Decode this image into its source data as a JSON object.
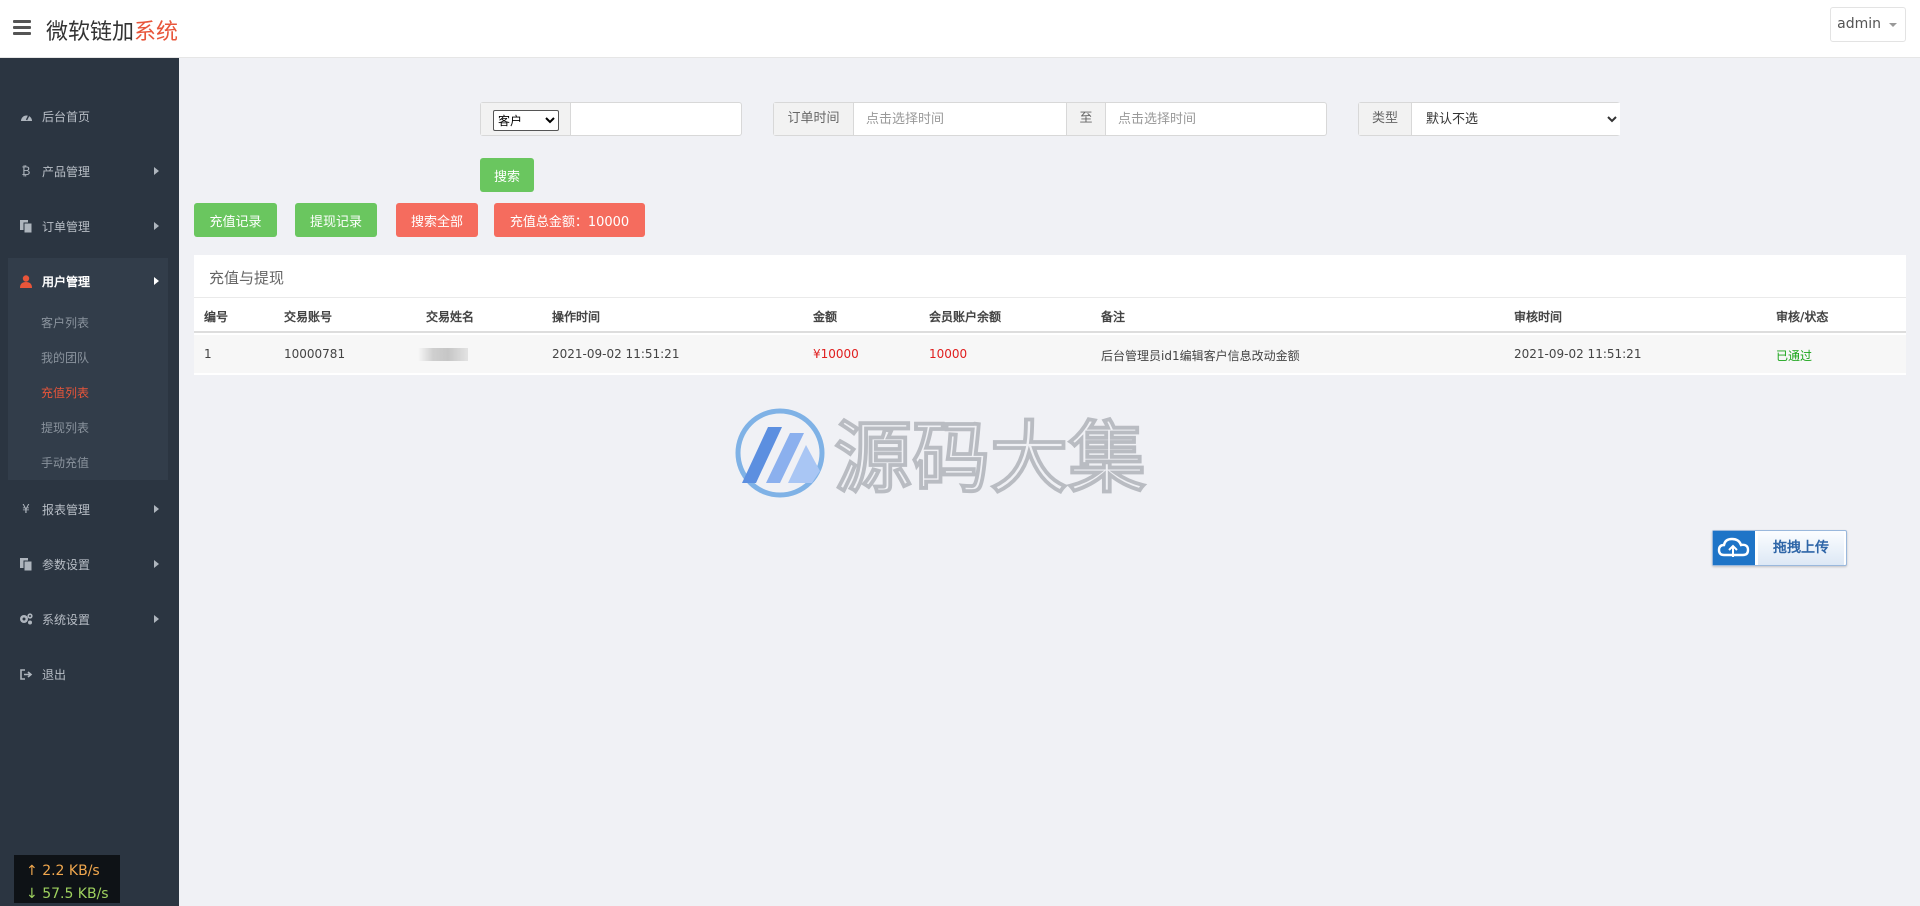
{
  "header": {
    "brand_main": "微软链加",
    "brand_accent": "系统",
    "user_label": "admin"
  },
  "sidebar": {
    "items": [
      {
        "label": "后台首页",
        "icon": "dashboard-icon"
      },
      {
        "label": "产品管理",
        "icon": "bitcoin-icon"
      },
      {
        "label": "订单管理",
        "icon": "copy-icon"
      },
      {
        "label": "用户管理",
        "icon": "user-icon"
      },
      {
        "label": "报表管理",
        "icon": "yen-icon"
      },
      {
        "label": "参数设置",
        "icon": "files-icon"
      },
      {
        "label": "系统设置",
        "icon": "gears-icon"
      },
      {
        "label": "退出",
        "icon": "sign-out-icon"
      }
    ],
    "user_submenu": [
      "客户列表",
      "我的团队",
      "充值列表",
      "提现列表",
      "手动充值"
    ],
    "active_submenu": "充值列表"
  },
  "netspeed": {
    "up_arrow": "↑",
    "up": "2.2 KB/s",
    "down_arrow": "↓",
    "down": "57.5 KB/s"
  },
  "filters": {
    "customer_select": "客户",
    "customer_options": [
      "客户"
    ],
    "order_time_label": "订单时间",
    "time_start_placeholder": "点击选择时间",
    "to_label": "至",
    "time_end_placeholder": "点击选择时间",
    "type_label": "类型",
    "type_select": "默认不选",
    "type_options": [
      "默认不选"
    ],
    "search_button": "搜索"
  },
  "actions": {
    "recharge_records": "充值记录",
    "withdraw_records": "提现记录",
    "search_all": "搜索全部",
    "recharge_total": "充值总金额：10000"
  },
  "table": {
    "title": "充值与提现",
    "columns": [
      "编号",
      "交易账号",
      "交易姓名",
      "操作时间",
      "金额",
      "会员账户余额",
      "备注",
      "审核时间",
      "审核/状态"
    ],
    "rows": [
      {
        "id": "1",
        "account": "10000781",
        "name": "",
        "op_time": "2021-09-02 11:51:21",
        "amount": "¥10000",
        "balance": "10000",
        "remark": "后台管理员id1编辑客户信息改动金额",
        "review_time": "2021-09-02 11:51:21",
        "status": "已通过"
      }
    ]
  },
  "watermark": {
    "text": "源码大集"
  },
  "upload": {
    "label": "拖拽上传"
  },
  "colors": {
    "accent": "#e8553a",
    "sidebar_bg": "#2b3541",
    "green_button": "#6ac65f",
    "red_button": "#f56c5e",
    "amount_red": "#e01e1e",
    "status_green": "#19a419",
    "upload_blue": "#1e74c7"
  }
}
